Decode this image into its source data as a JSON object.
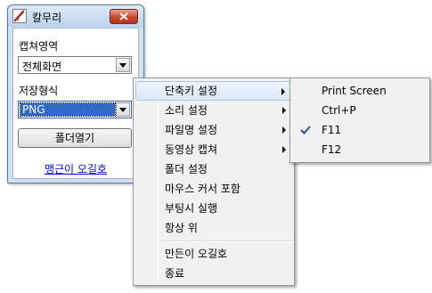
{
  "window": {
    "title": "칼무리",
    "capture_area_label": "캡쳐영역",
    "capture_area_value": "전체화면",
    "save_format_label": "저장형식",
    "save_format_value": "PNG",
    "open_folder_button": "폴더열기",
    "link_text": "맹근이 오길호"
  },
  "menu": {
    "items": [
      {
        "label": "단축키 설정",
        "has_submenu": true,
        "highlighted": true
      },
      {
        "label": "소리 설정",
        "has_submenu": true
      },
      {
        "label": "파일명 설정",
        "has_submenu": true
      },
      {
        "label": "동영상 캡쳐",
        "has_submenu": true
      },
      {
        "label": "폴더 설정"
      },
      {
        "label": "마우스 커서 포함"
      },
      {
        "label": "부팅시 실행"
      },
      {
        "label": "항상 위"
      },
      {
        "label": "만든이 오길호"
      },
      {
        "label": "종료"
      }
    ]
  },
  "submenu": {
    "items": [
      {
        "label": "Print Screen"
      },
      {
        "label": "Ctrl+P"
      },
      {
        "label": "F11",
        "checked": true
      },
      {
        "label": "F12"
      }
    ]
  },
  "colors": {
    "close_button": "#c9462e",
    "selection": "#3169c6",
    "link": "#0000e0",
    "menu_bg": "#f1f1f1"
  }
}
